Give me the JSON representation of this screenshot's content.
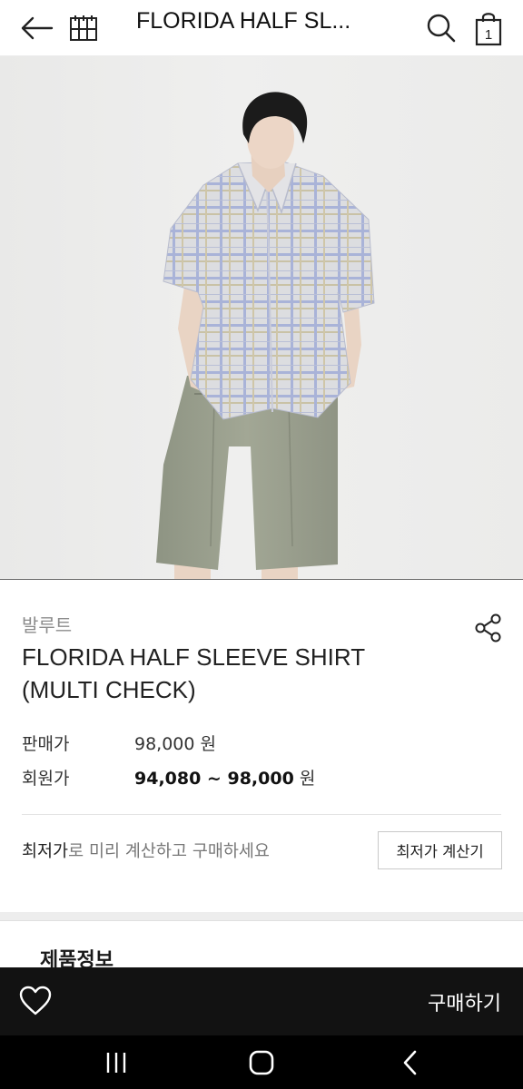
{
  "header": {
    "title": "FLORIDA HALF SL...",
    "icons": {
      "back": "back-arrow-icon",
      "brand": "brand-logo-icon",
      "search": "search-icon",
      "cart": "cart-icon"
    },
    "cart_count": "1"
  },
  "product": {
    "brand": "발루트",
    "name_line1": "FLORIDA HALF SLEEVE SHIRT",
    "name_line2": "(MULTI CHECK)",
    "price_label": "판매가",
    "price": "98,000",
    "member_label": "회원가",
    "member_price": "94,080 ~ 98,000",
    "currency": "원"
  },
  "calc": {
    "text_strong": "최저가",
    "text_rest": "로 미리 계산하고 구매하세요",
    "button_label": "최저가 계산기"
  },
  "tabs": {
    "product_info": "제품정보"
  },
  "action_bar": {
    "buy_label": "구매하기",
    "wish_icon": "heart-icon"
  },
  "colors": {
    "action_bar_bg": "#121212",
    "shirt_check": "#a9b3d8",
    "shorts": "#9aa08e"
  }
}
